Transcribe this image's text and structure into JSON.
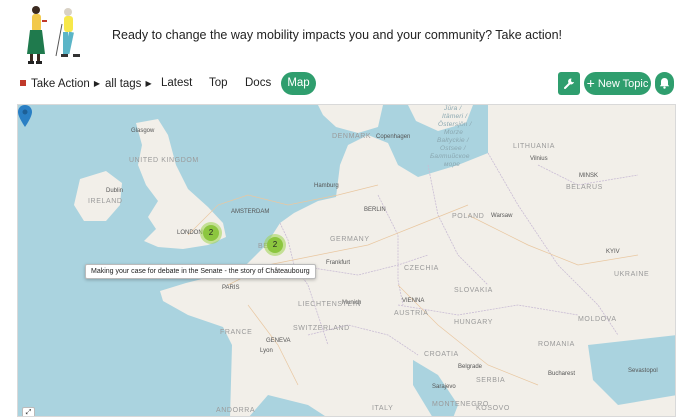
{
  "banner": {
    "text": "Ready to change the way mobility impacts you and your community? Take action!"
  },
  "nav": {
    "category": "Take Action",
    "tags": "all tags",
    "latest": "Latest",
    "top": "Top",
    "docs": "Docs",
    "map": "Map",
    "new_topic": "New Topic",
    "colors": {
      "accent": "#2f9e6e",
      "category": "#c0392b"
    }
  },
  "map": {
    "tooltip": "Making your case for debate in the Senate - the story of Châteaubourg",
    "clusters": [
      {
        "count": "2"
      },
      {
        "count": "2"
      }
    ],
    "labels": {
      "united_kingdom": "UNITED KINGDOM",
      "ireland": "IRELAND",
      "london": "LONDON",
      "glasgow": "Glasgow",
      "dublin": "Dublin",
      "belgium": "BE",
      "amsterdam": "AMSTERDAM",
      "paris": "PARIS",
      "france": "FRANCE",
      "denmark": "DENMARK",
      "copenhagen": "Copenhagen",
      "germany": "GERMANY",
      "berlin": "BERLIN",
      "hamburg": "Hamburg",
      "frankfurt": "Frankfurt",
      "munich": "Munich",
      "poland": "POLAND",
      "warsaw": "Warsaw",
      "czechia": "CZECHIA",
      "slovakia": "SLOVAKIA",
      "austria": "AUSTRIA",
      "vienna": "VIENNA",
      "hungary": "HUNGARY",
      "switzerland": "SWITZERLAND",
      "liechtenstein": "LIECHTENSTEIN",
      "geneva": "GENEVA",
      "lyon": "Lyon",
      "lithuania": "LITHUANIA",
      "vilnius": "Vilnius",
      "minsk": "MINSK",
      "belarus": "BELARUS",
      "kyiv": "KYIV",
      "ukraine": "UKRAINE",
      "moldova": "MOLDOVA",
      "romania": "ROMANIA",
      "bucharest": "Bucharest",
      "sevastopol": "Sevastopol",
      "croatia": "CROATIA",
      "serbia": "SERBIA",
      "belgrade": "Belgrade",
      "sarajevo": "Sarajevo",
      "montenegro": "MONTENEGRO",
      "kosovo": "KOSOVO",
      "italy": "ITALY",
      "andorra": "ANDORRA",
      "baltic1": "Itämeri /",
      "baltic2": "Östersjön /",
      "baltic3": "Morze",
      "baltic4": "Bałtyckie /",
      "baltic5": "Ostsee /",
      "baltic6": "Балтийское",
      "baltic7": "море",
      "baltic0": "Jūra /"
    }
  }
}
